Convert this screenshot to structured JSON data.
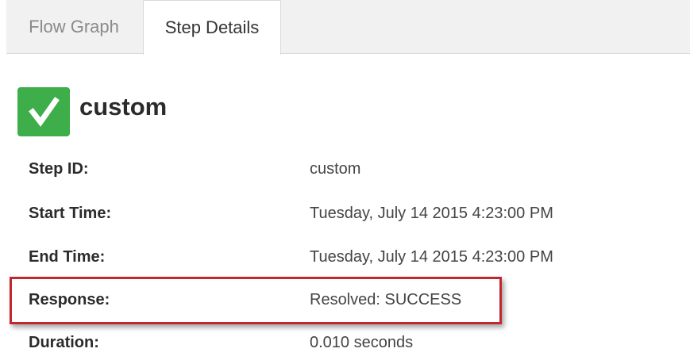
{
  "tabs": [
    {
      "label": "Flow Graph",
      "active": false
    },
    {
      "label": "Step Details",
      "active": true
    }
  ],
  "step": {
    "status_icon": "check-icon",
    "status_color": "#3dae49",
    "name": "custom"
  },
  "details": {
    "step_id": {
      "label": "Step ID:",
      "value": "custom"
    },
    "start_time": {
      "label": "Start Time:",
      "value": "Tuesday, July 14 2015 4:23:00 PM"
    },
    "end_time": {
      "label": "End Time:",
      "value": "Tuesday, July 14 2015 4:23:00 PM"
    },
    "response": {
      "label": "Response:",
      "value": "Resolved: SUCCESS"
    },
    "duration": {
      "label": "Duration:",
      "value": "0.010 seconds"
    }
  },
  "highlight_color": "#c0282d"
}
